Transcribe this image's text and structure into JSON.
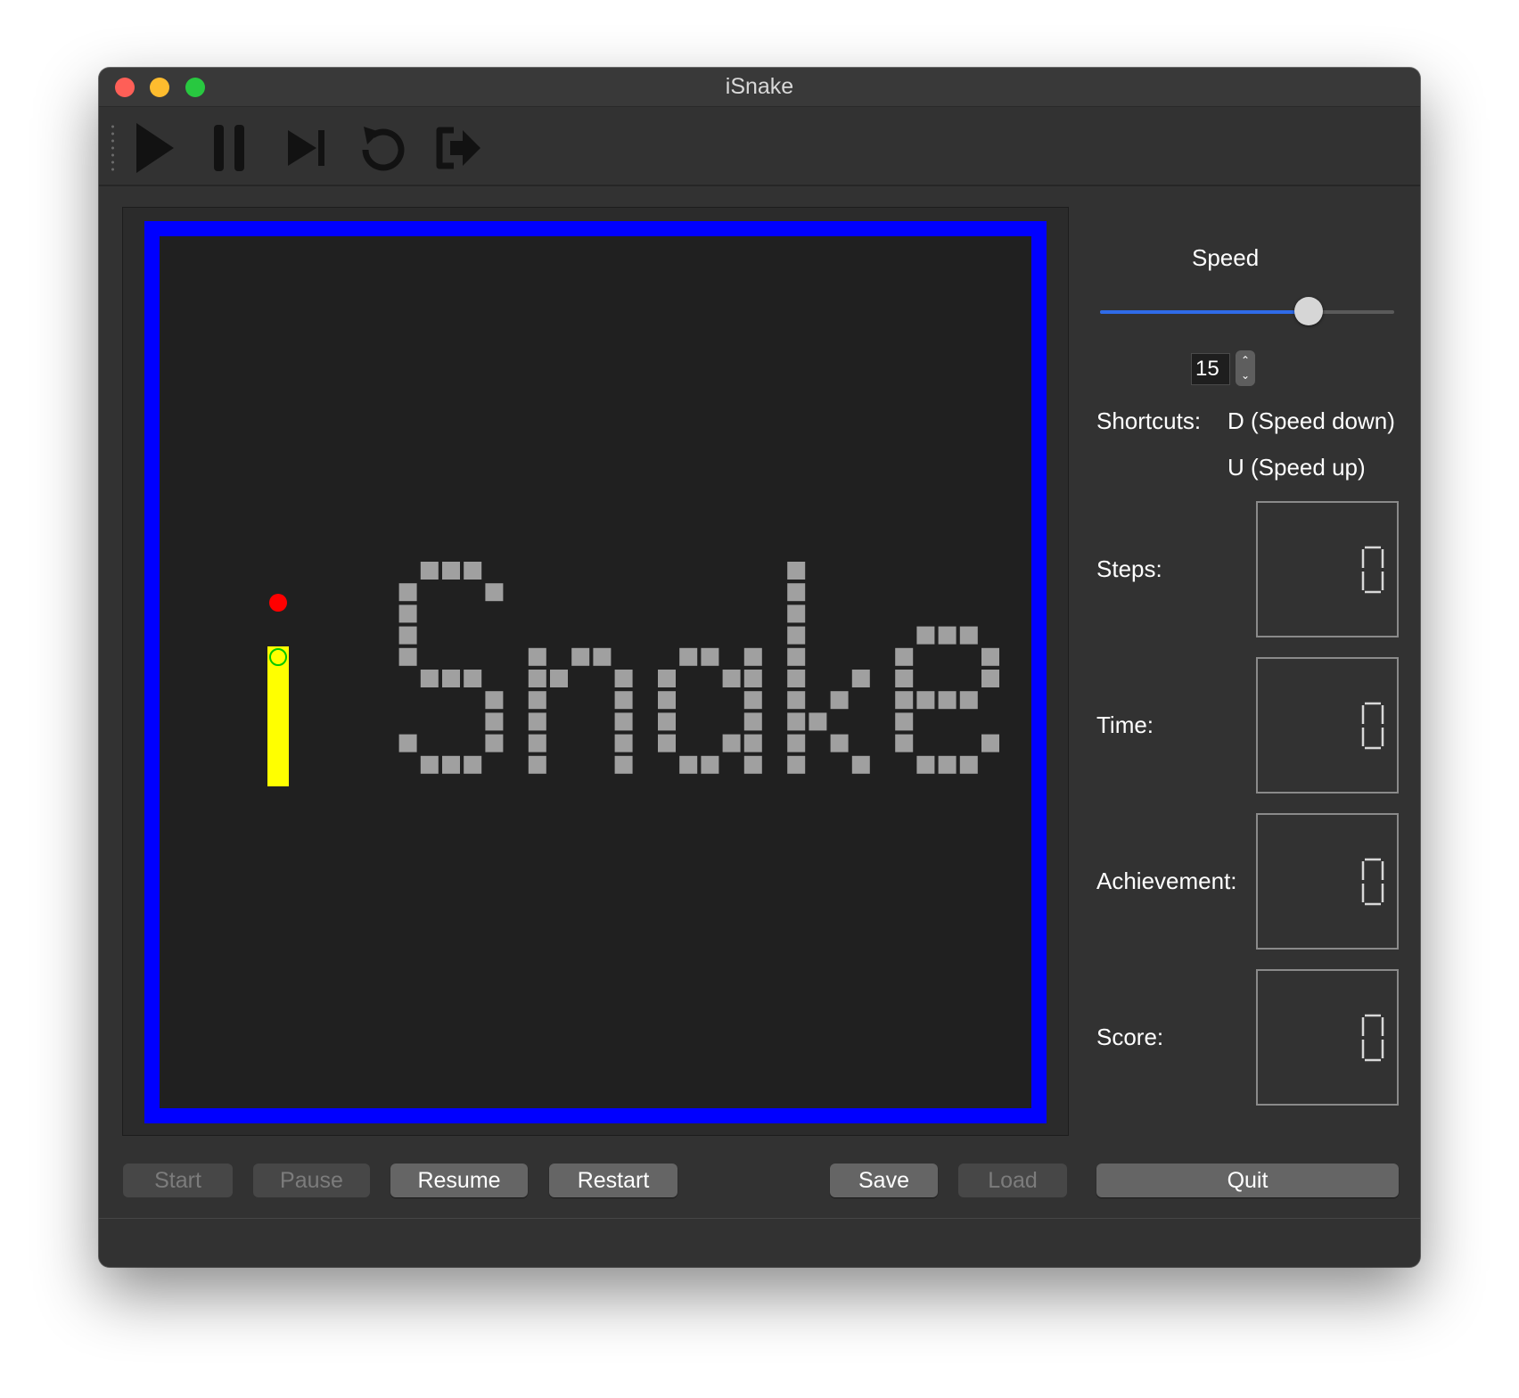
{
  "window": {
    "title": "iSnake",
    "traffic_lights": {
      "close": "#fe5f57",
      "minimize": "#febc2e",
      "zoom": "#28c840"
    }
  },
  "toolbar": {
    "items": [
      {
        "name": "play-icon",
        "label": ""
      },
      {
        "name": "pause-icon",
        "label": ""
      },
      {
        "name": "step-forward-icon",
        "label": ""
      },
      {
        "name": "restart-icon",
        "label": ""
      },
      {
        "name": "exit-icon",
        "label": ""
      }
    ]
  },
  "board": {
    "wall_color": "#0000ff",
    "background": "#202020",
    "brick_color": "#a0a0a0",
    "snake_color": "#ffff00",
    "snake_head_ring_color": "#00c800",
    "food_color": "#ff0000",
    "title_art": "iSnake"
  },
  "speed": {
    "label": "Speed",
    "value": "15",
    "slider_fraction": 0.71,
    "accent": "#2f6be8"
  },
  "shortcuts": {
    "label": "Shortcuts:",
    "down": "D (Speed down)",
    "up": "U (Speed up)"
  },
  "stats": {
    "steps": {
      "label": "Steps:",
      "value": "0"
    },
    "time": {
      "label": "Time:",
      "value": "0"
    },
    "achievement": {
      "label": "Achievement:",
      "value": "0"
    },
    "score": {
      "label": "Score:",
      "value": "0"
    }
  },
  "buttons": {
    "start": "Start",
    "pause": "Pause",
    "resume": "Resume",
    "restart": "Restart",
    "save": "Save",
    "load": "Load",
    "quit": "Quit"
  }
}
